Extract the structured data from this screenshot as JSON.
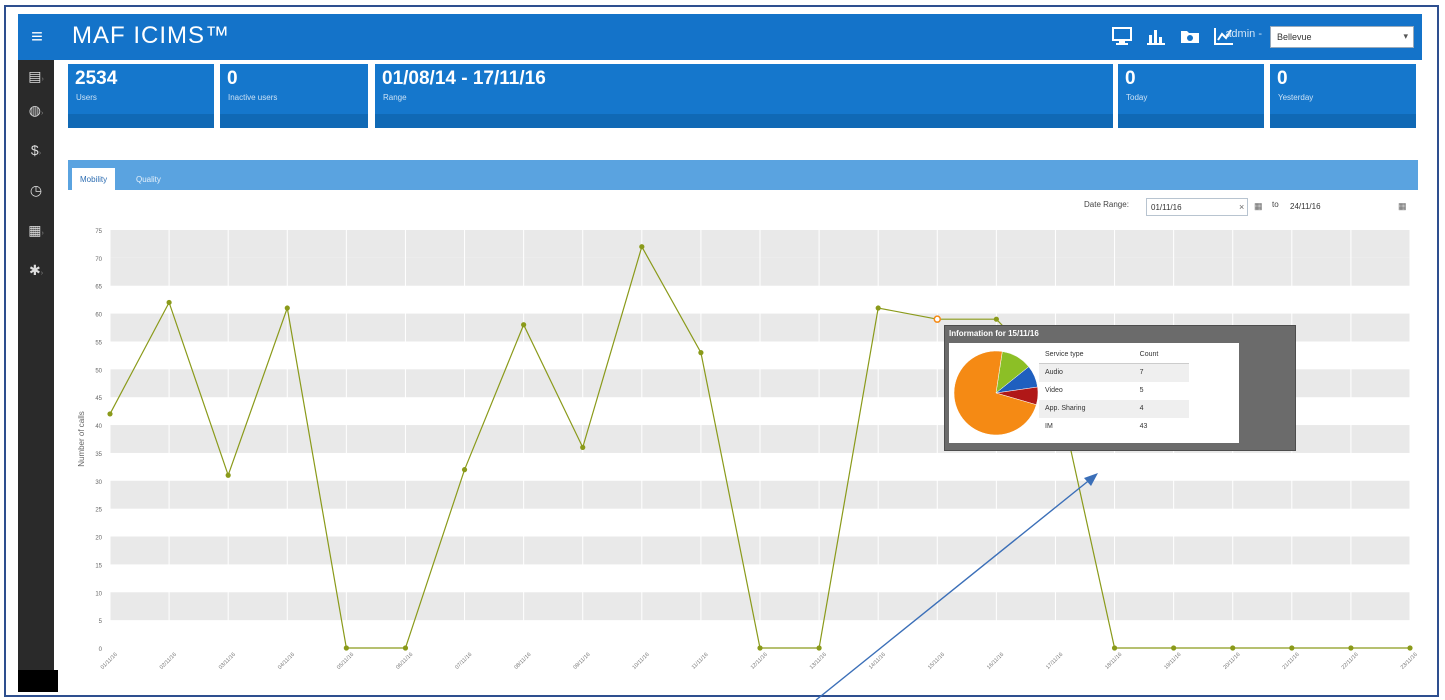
{
  "header": {
    "menu_icon": "hamburger-icon",
    "title": "MAF ICIMS™",
    "icons": [
      "monitor-icon",
      "bar-chart-icon",
      "folder-icon",
      "line-chart-icon"
    ],
    "admin_label": "admin -",
    "region_value": "Bellevue"
  },
  "sidebar": {
    "items": [
      {
        "icon": "document-icon",
        "glyph": "▤"
      },
      {
        "icon": "globe-icon",
        "glyph": "◍"
      },
      {
        "icon": "dollar-icon",
        "glyph": "$"
      },
      {
        "icon": "clock-icon",
        "glyph": "◷"
      },
      {
        "icon": "grid-icon",
        "glyph": "▦"
      },
      {
        "icon": "gear-icon",
        "glyph": "✱"
      }
    ]
  },
  "stats": {
    "users": {
      "value": "2534",
      "label": "Users"
    },
    "inactive": {
      "value": "0",
      "label": "Inactive users"
    },
    "range": {
      "value": "01/08/14 - 17/11/16",
      "label": "Range"
    },
    "today": {
      "value": "0",
      "label": "Today"
    },
    "yesterday": {
      "value": "0",
      "label": "Yesterday"
    }
  },
  "tabs": [
    {
      "label": "Mobility",
      "active": true
    },
    {
      "label": "Quality",
      "active": false
    }
  ],
  "filter": {
    "date_range_label": "Date Range:",
    "from": "01/11/16",
    "to_label": "to",
    "to": "24/11/16"
  },
  "chart_data": {
    "type": "line",
    "ylabel": "Number of calls",
    "ylim": [
      0,
      75
    ],
    "yticks": [
      0,
      5,
      10,
      15,
      20,
      25,
      30,
      35,
      40,
      45,
      50,
      55,
      60,
      65,
      70,
      75
    ],
    "x": [
      "01/11/16",
      "02/11/16",
      "03/11/16",
      "04/11/16",
      "05/11/16",
      "06/11/16",
      "07/11/16",
      "08/11/16",
      "09/11/16",
      "10/11/16",
      "11/11/16",
      "12/11/16",
      "13/11/16",
      "14/11/16",
      "15/11/16",
      "16/11/16",
      "17/11/16",
      "18/11/16",
      "19/11/16",
      "20/11/16",
      "21/11/16",
      "22/11/16",
      "23/11/16"
    ],
    "values": [
      42,
      62,
      31,
      61,
      0,
      0,
      32,
      58,
      36,
      72,
      53,
      0,
      0,
      61,
      59,
      59,
      48,
      0,
      0,
      0,
      0,
      0,
      0
    ],
    "highlight_index": 14,
    "series_color": "#8a9a1a",
    "band_color": "#e9e9e9"
  },
  "tooltip": {
    "title": "Information for 15/11/16",
    "headers": [
      "Service type",
      "Count"
    ],
    "rows": [
      {
        "type": "Audio",
        "count": "7"
      },
      {
        "type": "Video",
        "count": "5"
      },
      {
        "type": "App. Sharing",
        "count": "4"
      },
      {
        "type": "IM",
        "count": "43"
      }
    ],
    "pie": [
      {
        "value": 7,
        "color": "#8cbf26"
      },
      {
        "value": 5,
        "color": "#1f5fbf"
      },
      {
        "value": 4,
        "color": "#b01818"
      },
      {
        "value": 43,
        "color": "#f58a14"
      }
    ]
  }
}
